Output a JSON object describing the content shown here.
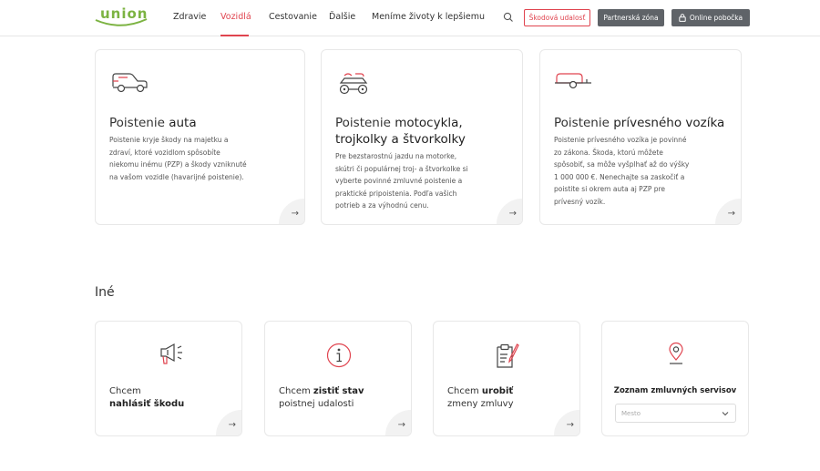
{
  "header": {
    "logo": "union",
    "nav": [
      "Zdravie",
      "Vozidlá",
      "Cestovanie",
      "Ďalšie",
      "Meníme životy k lepšiemu"
    ],
    "active_nav": "Vozidlá",
    "claim_button": "Škodová udalosť",
    "partner_button": "Partnerská zóna",
    "online_button": "Online pobočka"
  },
  "products": [
    {
      "title_prefix": "Poistenie ",
      "title_bold": "auta",
      "description": [
        "Poistenie kryje škody na majetku a",
        "zdraví, ktoré vozidlom spôsobíte",
        "niekomu inému (PZP) a škody vzniknuté",
        "na vašom vozidle (havarijné poistenie)."
      ],
      "icon": "car-icon"
    },
    {
      "title_prefix": "Poistenie ",
      "title_bold": "motocykla,",
      "title_line2": "trojkolky a štvorkolky",
      "description": [
        "Pre bezstarostnú jazdu na motorke,",
        "skútri či populárnej troj- a štvorkolke si",
        "vyberte povinné zmluvné poistenie a",
        "praktické pripoistenia. Podľa vašich",
        "potrieb a za výhodnú cenu."
      ],
      "icon": "quad-bike-icon"
    },
    {
      "title_prefix": "Poistenie ",
      "title_bold": "prívesného vozíka",
      "description": [
        "Poistenie prívesného vozíka je povinné",
        "zo zákona. Škoda, ktorú môžete",
        "spôsobiť, sa môže vyšplhať až do výšky",
        "1 000 000 €. Nenechajte sa zaskočiť a",
        "poistite si okrem auta aj PZP pre",
        "prívesný vozík."
      ],
      "icon": "trailer-icon"
    }
  ],
  "other_section": {
    "title": "Iné",
    "cards": [
      {
        "line1": "Chcem",
        "line2_bold": "nahlásiť škodu",
        "line2_rest": "",
        "icon": "megaphone-icon"
      },
      {
        "line1_prefix": "Chcem ",
        "line1_bold": "zistiť stav",
        "line2": "poistnej udalosti",
        "icon": "info-icon"
      },
      {
        "line1_prefix": "Chcem ",
        "line1_bold": "urobiť",
        "line2": "zmeny zmluvy",
        "icon": "clipboard-pen-icon"
      }
    ],
    "servis": {
      "title": "Zoznam zmluvných servisov",
      "select_placeholder": "Mesto"
    }
  },
  "colors": {
    "accent": "#e0444f",
    "brand_green": "#7cb342",
    "dark_button": "#5f6368"
  }
}
